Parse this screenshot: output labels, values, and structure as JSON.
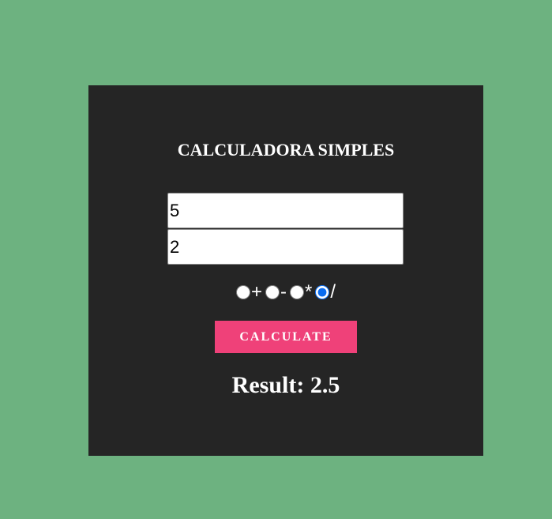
{
  "title": "CALCULADORA SIMPLES",
  "inputs": {
    "first": "5",
    "second": "2"
  },
  "operations": [
    {
      "label": "+",
      "value": "add",
      "checked": false
    },
    {
      "label": "-",
      "value": "subtract",
      "checked": false
    },
    {
      "label": "*",
      "value": "multiply",
      "checked": false
    },
    {
      "label": "/",
      "value": "divide",
      "checked": true
    }
  ],
  "button": {
    "label": "CALCULATE"
  },
  "result": {
    "label": "Result:",
    "value": "2.5"
  },
  "colors": {
    "background": "#6db280",
    "panel": "#252525",
    "button": "#ef4179",
    "text": "#ffffff"
  }
}
